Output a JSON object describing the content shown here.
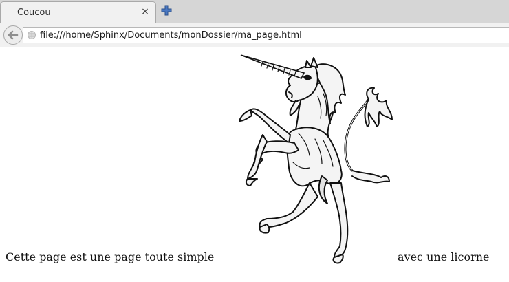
{
  "window": {
    "tab_title": "Coucou",
    "close_tab_glyph": "×",
    "icons": [
      "close-icon",
      "new-tab-plus-icon",
      "back-arrow-icon",
      "globe-icon"
    ]
  },
  "navbar": {
    "url": "file:///home/Sphinx/Documents/monDossier/ma_page.html"
  },
  "page": {
    "image_name": "unicorn-image",
    "text_left": "Cette page est une page toute simple",
    "text_right": "avec une licorne"
  }
}
